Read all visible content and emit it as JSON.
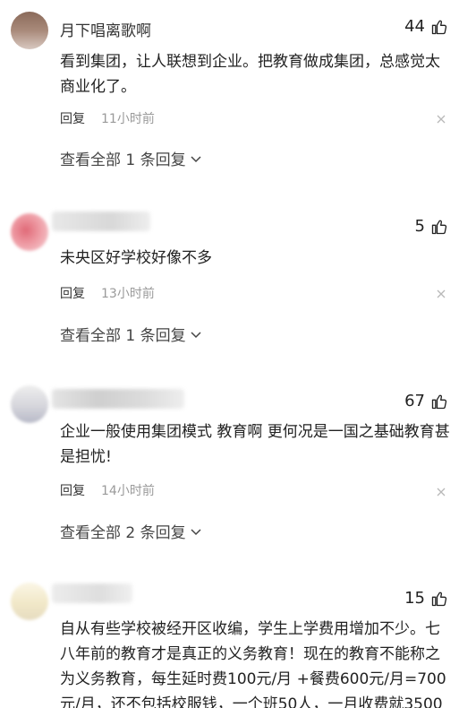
{
  "comments": [
    {
      "username": "月下唱离歌啊",
      "likes": "44",
      "text": "看到集团，让人联想到企业。把教育做成集团，总感觉太商业化了。",
      "reply_label": "回复",
      "time": "11小时前",
      "view_all": "查看全部 1 条回复"
    },
    {
      "username": "",
      "likes": "5",
      "text": "未央区好学校好像不多",
      "reply_label": "回复",
      "time": "13小时前",
      "view_all": "查看全部 1 条回复"
    },
    {
      "username": "",
      "likes": "67",
      "text": "企业一般使用集团模式 教育啊 更何况是一国之基础教育甚是担忧!",
      "reply_label": "回复",
      "time": "14小时前",
      "view_all": "查看全部 2 条回复"
    },
    {
      "username": "",
      "likes": "15",
      "text": "自从有些学校被经开区收编，学生上学费用增加不少。七八年前的教育才是真正的义务教育！现在的教育不能称之为义务教育，每生延时费100元/月 +餐费600元/月=700元/月，还不包括校服钱，一个班50人，一月收费就3500"
    }
  ],
  "icons": {
    "like": "thumbs-up-icon",
    "close": "close-icon",
    "expand": "chevron-down-icon"
  }
}
